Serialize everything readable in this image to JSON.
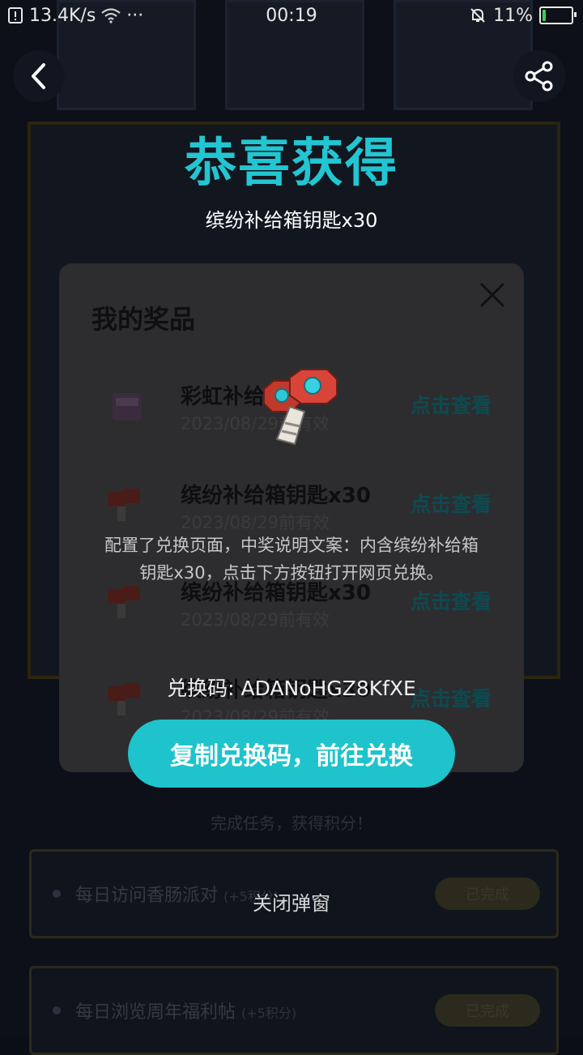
{
  "status_bar": {
    "speed": "13.4K/s",
    "more": "···",
    "time": "00:19",
    "battery_percent": "11%",
    "battery_level": 0.11
  },
  "header": {
    "title": "恭喜获得",
    "subtitle": "缤纷补给箱钥匙x30"
  },
  "prize_panel": {
    "title": "我的奖品",
    "items": [
      {
        "name": "彩虹补给箱",
        "date": "2023/08/29前有效",
        "action": "点击查看"
      },
      {
        "name": "缤纷补给箱钥匙x30",
        "date": "2023/08/29前有效",
        "action": "点击查看"
      },
      {
        "name": "缤纷补给箱钥匙x30",
        "date": "2023/08/29前有效",
        "action": "点击查看"
      },
      {
        "name": "缤纷补给箱钥匙x30",
        "date": "2023/08/29前有效",
        "action": "点击查看"
      }
    ]
  },
  "popup": {
    "description": "配置了兑换页面，中奖说明文案：内含缤纷补给箱钥匙x30，点击下方按钮打开网页兑换。",
    "code": "兑换码: ADANoHGZ8KfXE",
    "copy_button": "复制兑换码，前往兑换",
    "close": "关闭弹窗"
  },
  "background": {
    "hint": "完成任务，获得积分！",
    "tasks": [
      {
        "text": "每日访问香肠派对",
        "points": "(+5积分)",
        "button": "已完成"
      },
      {
        "text": "每日浏览周年福利帖",
        "points": "(+5积分)",
        "button": "已完成"
      }
    ]
  },
  "colors": {
    "accent": "#22c6d2",
    "button": "#1fc3cc",
    "panel": "#2d2d2f"
  }
}
